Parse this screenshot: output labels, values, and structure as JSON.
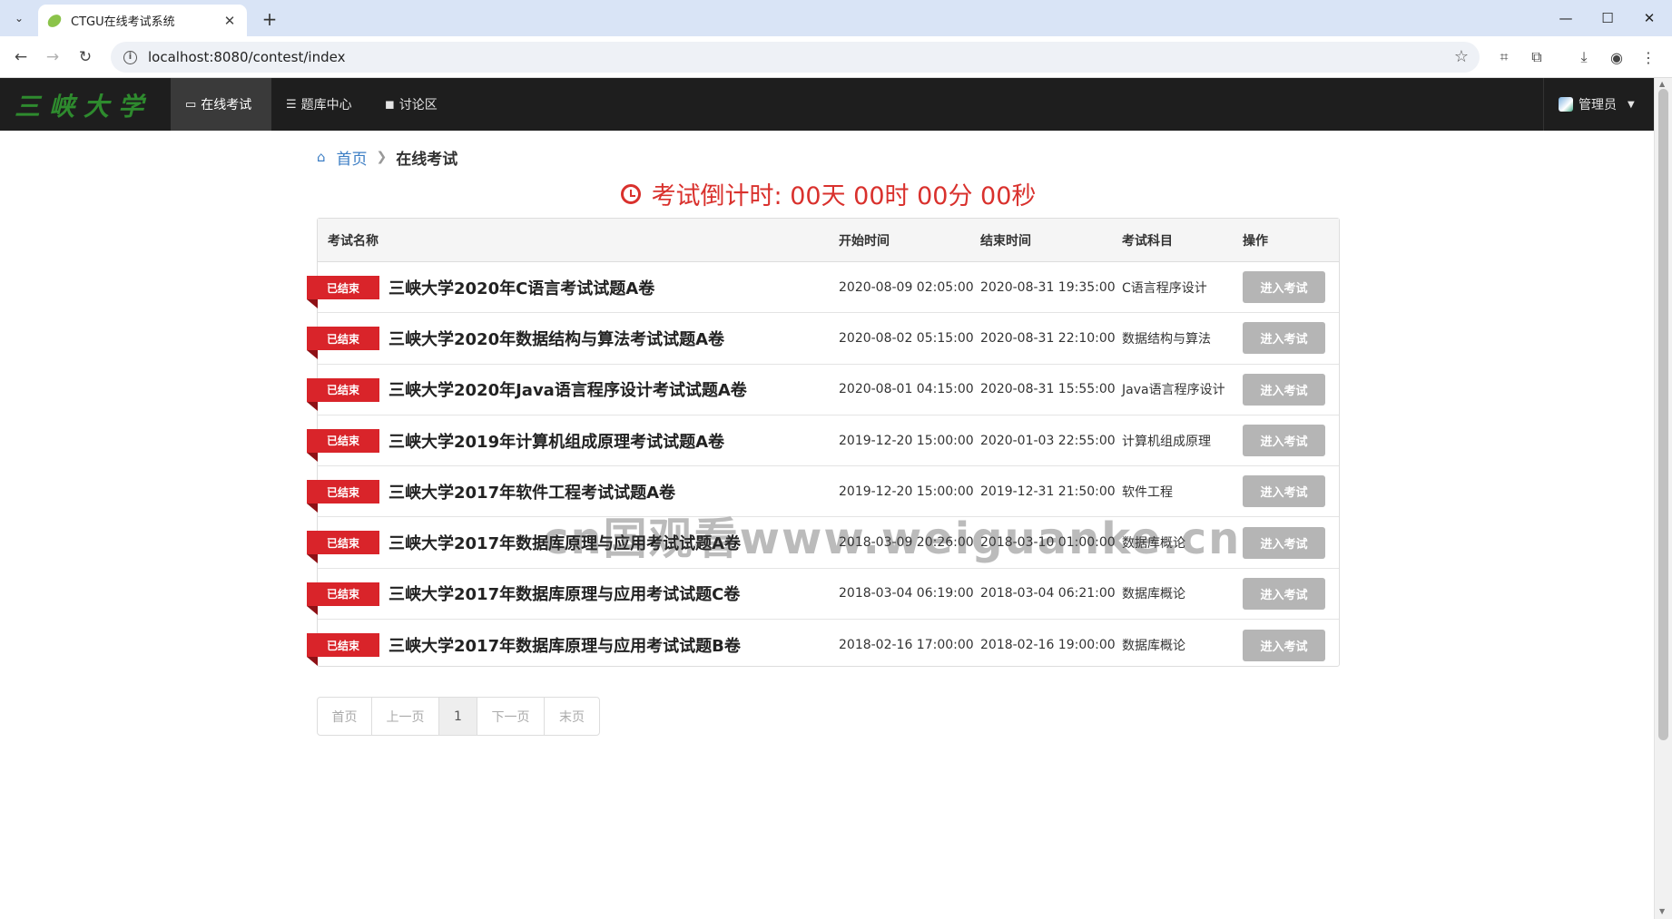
{
  "browser": {
    "tab_title": "CTGU在线考试系统",
    "tab_close": "✕",
    "new_tab": "+",
    "url": "localhost:8080/contest/index",
    "window_controls": {
      "minimize": "—",
      "maximize": "☐",
      "close": "✕"
    }
  },
  "navbar": {
    "logo_text": "三峡大学",
    "items": [
      {
        "label": "在线考试",
        "icon": "desktop-icon",
        "active": true
      },
      {
        "label": "题库中心",
        "icon": "list-icon",
        "active": false
      },
      {
        "label": "讨论区",
        "icon": "comment-icon",
        "active": false
      }
    ],
    "user": "管理员"
  },
  "breadcrumb": {
    "home": "首页",
    "current": "在线考试"
  },
  "countdown": "考试倒计时: 00天 00时 00分 00秒",
  "table": {
    "headers": {
      "name": "考试名称",
      "start": "开始时间",
      "end": "结束时间",
      "subject": "考试科目",
      "op": "操作"
    },
    "rows": [
      {
        "status": "已结束",
        "name": "三峡大学2020年C语言考试试题A卷",
        "start": "2020-08-09 02:05:00",
        "end": "2020-08-31 19:35:00",
        "subject": "C语言程序设计",
        "action": "进入考试"
      },
      {
        "status": "已结束",
        "name": "三峡大学2020年数据结构与算法考试试题A卷",
        "start": "2020-08-02 05:15:00",
        "end": "2020-08-31 22:10:00",
        "subject": "数据结构与算法",
        "action": "进入考试"
      },
      {
        "status": "已结束",
        "name": "三峡大学2020年Java语言程序设计考试试题A卷",
        "start": "2020-08-01 04:15:00",
        "end": "2020-08-31 15:55:00",
        "subject": "Java语言程序设计",
        "action": "进入考试"
      },
      {
        "status": "已结束",
        "name": "三峡大学2019年计算机组成原理考试试题A卷",
        "start": "2019-12-20 15:00:00",
        "end": "2020-01-03 22:55:00",
        "subject": "计算机组成原理",
        "action": "进入考试"
      },
      {
        "status": "已结束",
        "name": "三峡大学2017年软件工程考试试题A卷",
        "start": "2019-12-20 15:00:00",
        "end": "2019-12-31 21:50:00",
        "subject": "软件工程",
        "action": "进入考试"
      },
      {
        "status": "已结束",
        "name": "三峡大学2017年数据库原理与应用考试试题A卷",
        "start": "2018-03-09 20:26:00",
        "end": "2018-03-10 01:00:00",
        "subject": "数据库概论",
        "action": "进入考试"
      },
      {
        "status": "已结束",
        "name": "三峡大学2017年数据库原理与应用考试试题C卷",
        "start": "2018-03-04 06:19:00",
        "end": "2018-03-04 06:21:00",
        "subject": "数据库概论",
        "action": "进入考试"
      },
      {
        "status": "已结束",
        "name": "三峡大学2017年数据库原理与应用考试试题B卷",
        "start": "2018-02-16 17:00:00",
        "end": "2018-02-16 19:00:00",
        "subject": "数据库概论",
        "action": "进入考试"
      }
    ]
  },
  "pagination": {
    "first": "首页",
    "prev": "上一页",
    "current": "1",
    "next": "下一页",
    "last": "末页"
  },
  "watermark": "cn国观看www.weiguanke.cn",
  "colors": {
    "navbar_bg": "#1e1e1e",
    "accent_red": "#d9242a",
    "countdown": "#d9312d",
    "link_blue": "#3b7dc4",
    "button_disabled": "#b5b5b5"
  }
}
